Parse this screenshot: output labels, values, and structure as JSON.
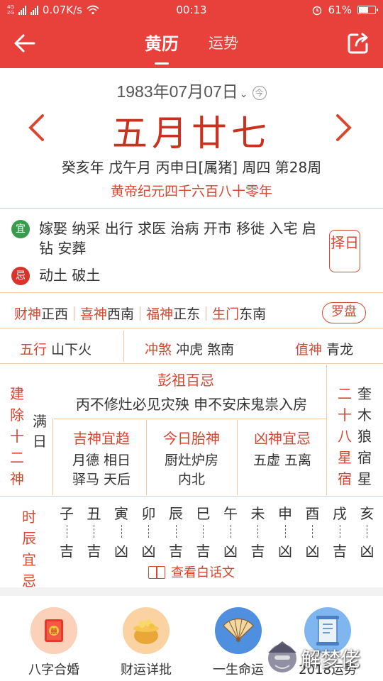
{
  "status_bar": {
    "network_top": "4G",
    "network_bottom": "2G",
    "speed": "0.07K/s",
    "time": "00:13",
    "battery": "61%",
    "battery_level": 0.61
  },
  "header": {
    "tabs": [
      {
        "label": "黄历",
        "active": true
      },
      {
        "label": "运势",
        "active": false
      }
    ]
  },
  "date": {
    "solar": "1983年07月07日",
    "chevron": "⌄",
    "today_icon": "今",
    "lunar": "五月廿七",
    "ganzhi": "癸亥年 戊午月 丙申日[属猪] 周四 第28周",
    "huangdi": "黄帝纪元四千六百八十零年"
  },
  "yi_ji": {
    "yi_badge": "宜",
    "yi_text": "嫁娶 纳采 出行 求医 治病 开市 移徙 入宅 启钻 安葬",
    "ji_badge": "忌",
    "ji_text": "动土 破土",
    "zeri_button": "择日"
  },
  "gods": [
    {
      "label": "财神",
      "value": "正西"
    },
    {
      "label": "喜神",
      "value": "西南"
    },
    {
      "label": "福神",
      "value": "正东"
    },
    {
      "label": "生门",
      "value": "东南"
    }
  ],
  "luopan_button": "罗盘",
  "row3": {
    "wuxing_label": "五行",
    "wuxing_value": "山下火",
    "chongsha_label": "冲煞",
    "chongsha_value": "冲虎 煞南",
    "zhishen_label": "值神",
    "zhishen_value": "青龙"
  },
  "jianchu": {
    "label": "建除十二神",
    "value": "满日"
  },
  "xingxiu": {
    "label": "二十八星宿",
    "value": "奎木狼宿星"
  },
  "pengzu": {
    "title": "彭祖百忌",
    "text": "丙不修灶必见灾殃 申不安床鬼祟入房"
  },
  "jishen": {
    "title": "吉神宜趋",
    "line1": "月德 相日",
    "line2": "驿马 天后"
  },
  "taishen": {
    "title": "今日胎神",
    "line1": "厨灶炉房",
    "line2": "内北"
  },
  "xiongshen": {
    "title": "凶神宜忌",
    "line1": "五虚 五离"
  },
  "shichen": {
    "label": "时辰宜忌",
    "hours": [
      {
        "branch": "子",
        "luck": "吉"
      },
      {
        "branch": "丑",
        "luck": "吉"
      },
      {
        "branch": "寅",
        "luck": "凶"
      },
      {
        "branch": "卯",
        "luck": "凶"
      },
      {
        "branch": "辰",
        "luck": "吉"
      },
      {
        "branch": "巳",
        "luck": "吉"
      },
      {
        "branch": "午",
        "luck": "凶"
      },
      {
        "branch": "未",
        "luck": "吉"
      },
      {
        "branch": "申",
        "luck": "凶"
      },
      {
        "branch": "酉",
        "luck": "凶"
      },
      {
        "branch": "戌",
        "luck": "吉"
      },
      {
        "branch": "亥",
        "luck": "凶"
      }
    ]
  },
  "baihua_link": "查看白话文",
  "services": [
    {
      "label": "八字合婚",
      "icon": "marriage-book-icon"
    },
    {
      "label": "财运详批",
      "icon": "golden-pot-icon"
    },
    {
      "label": "一生命运",
      "icon": "folding-fan-icon"
    },
    {
      "label": "2018运势",
      "icon": "fortune-scroll-icon"
    }
  ],
  "watermark": "解梦佬",
  "colors": {
    "brand": "#e8413c",
    "accent": "#d9462f",
    "lunar": "#c8321f",
    "yi": "#3a9b4f",
    "ji": "#d9342a"
  }
}
